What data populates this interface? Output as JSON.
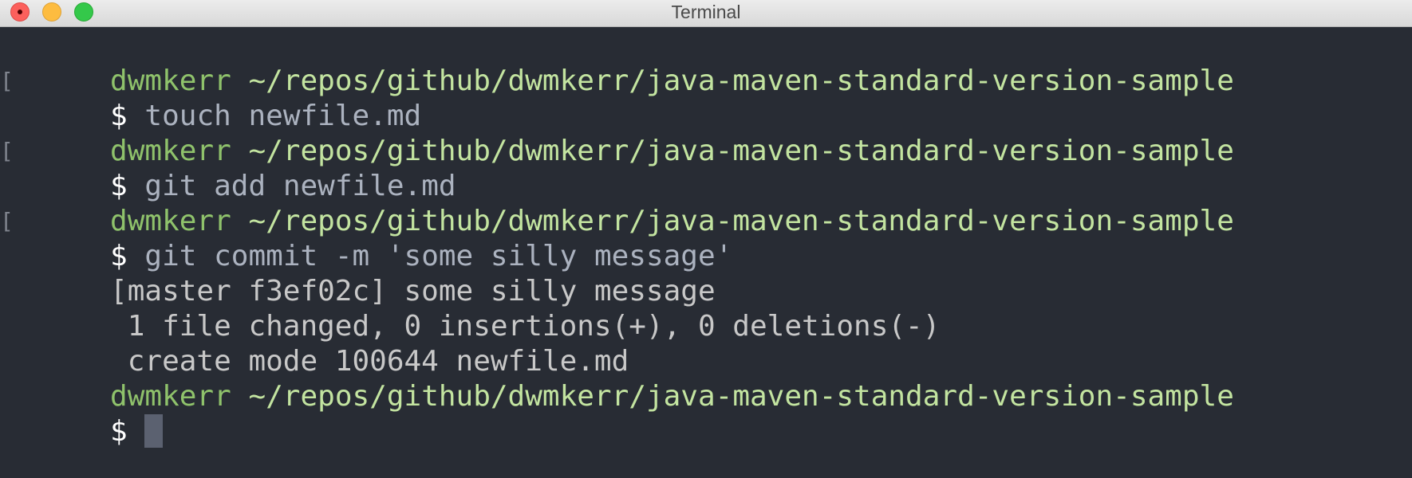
{
  "window": {
    "title": "Terminal"
  },
  "terminal": {
    "lines": [
      {
        "type": "prompt-header",
        "user": "dwmkerr",
        "path": "~/repos/github/dwmkerr/java-maven-standard-version-sample"
      },
      {
        "type": "command",
        "bracket": "[",
        "prompt": "$",
        "text": "touch newfile.md"
      },
      {
        "type": "prompt-header",
        "user": "dwmkerr",
        "path": "~/repos/github/dwmkerr/java-maven-standard-version-sample"
      },
      {
        "type": "command",
        "bracket": "[",
        "prompt": "$",
        "text": "git add newfile.md"
      },
      {
        "type": "prompt-header",
        "user": "dwmkerr",
        "path": "~/repos/github/dwmkerr/java-maven-standard-version-sample"
      },
      {
        "type": "command",
        "bracket": "[",
        "prompt": "$",
        "text": "git commit -m 'some silly message'"
      },
      {
        "type": "output",
        "text": "[master f3ef02c] some silly message"
      },
      {
        "type": "output",
        "text": " 1 file changed, 0 insertions(+), 0 deletions(-)"
      },
      {
        "type": "output",
        "text": " create mode 100644 newfile.md"
      },
      {
        "type": "prompt-header",
        "user": "dwmkerr",
        "path": "~/repos/github/dwmkerr/java-maven-standard-version-sample"
      },
      {
        "type": "active-prompt",
        "prompt": "$"
      }
    ]
  },
  "colors": {
    "background": "#282c34",
    "user": "#8fc26b",
    "path": "#c3e4a0",
    "text": "#abb2bf",
    "cursor": "#5b6170"
  }
}
